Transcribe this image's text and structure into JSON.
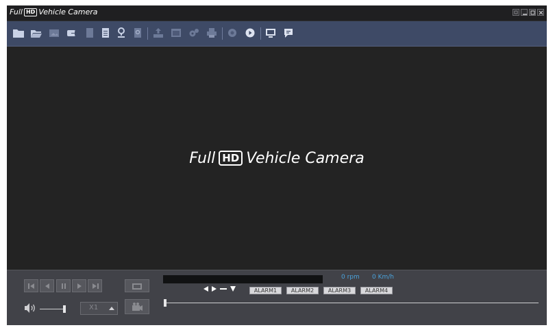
{
  "window": {
    "title_full": "Full",
    "title_hd": "HD",
    "title_rest": "Vehicle Camera",
    "controls": [
      "minimize-icon",
      "restore-icon",
      "maximize-icon",
      "close-icon"
    ]
  },
  "toolbar": {
    "icons": [
      "folder-icon",
      "open-folder-icon",
      "image-icon",
      "export-icon",
      "document-icon",
      "document-lines-icon",
      "map-pin-icon",
      "search-document-icon",
      "upload-icon",
      "window-icon",
      "settings-gear-icon",
      "printer-icon",
      "record-icon",
      "play-circle-icon",
      "screen-icon",
      "chat-bubble-icon"
    ]
  },
  "video": {
    "watermark_full": "Full",
    "watermark_hd": "HD",
    "watermark_rest": "Vehicle Camera"
  },
  "playback": {
    "buttons": [
      "skip-back-icon",
      "step-back-icon",
      "pause-icon",
      "play-icon",
      "skip-forward-icon"
    ],
    "speed_label": "X1",
    "rpm_text": "0 rpm",
    "speed_text": "0 Km/h",
    "alarms": [
      "ALARM1",
      "ALARM2",
      "ALARM3",
      "ALARM4"
    ],
    "volume_level": 1.0,
    "seek_position": 0.0
  },
  "colors": {
    "toolbar_bg": "#3e4a66",
    "video_bg": "#232323",
    "controls_bg": "#414248",
    "telemetry_text": "#4aa3dc"
  }
}
